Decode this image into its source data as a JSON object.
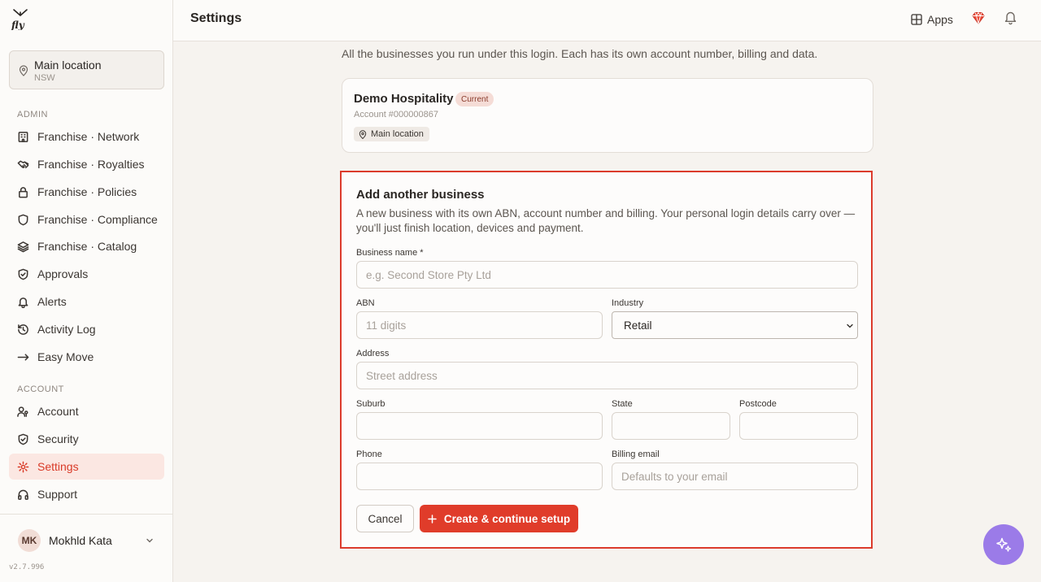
{
  "app": {
    "version": "v2.7.996"
  },
  "header": {
    "title": "Settings",
    "apps_label": "Apps"
  },
  "sidebar": {
    "location": {
      "name": "Main location",
      "state": "NSW"
    },
    "admin_label": "ADMIN",
    "account_label": "ACCOUNT",
    "admin_items": [
      {
        "label": "Franchise · Network",
        "icon": "building-icon"
      },
      {
        "label": "Franchise · Royalties",
        "icon": "handshake-icon"
      },
      {
        "label": "Franchise · Policies",
        "icon": "lock-icon"
      },
      {
        "label": "Franchise · Compliance",
        "icon": "shield-icon"
      },
      {
        "label": "Franchise · Catalog",
        "icon": "layers-icon"
      },
      {
        "label": "Approvals",
        "icon": "shield-check-icon"
      },
      {
        "label": "Alerts",
        "icon": "bell-icon"
      },
      {
        "label": "Activity Log",
        "icon": "history-icon"
      },
      {
        "label": "Easy Move",
        "icon": "arrow-right-icon"
      }
    ],
    "account_items": [
      {
        "label": "Account",
        "icon": "user-key-icon"
      },
      {
        "label": "Security",
        "icon": "shield-icon"
      },
      {
        "label": "Settings",
        "icon": "gear-icon",
        "active": true
      },
      {
        "label": "Support",
        "icon": "headphones-icon"
      }
    ],
    "user": {
      "initials": "MK",
      "name": "Mokhld Kata"
    }
  },
  "main": {
    "intro": "All the businesses you run under this login. Each has its own account number, billing and data.",
    "business": {
      "name": "Demo Hospitality",
      "badge": "Current",
      "account": "Account #000000867",
      "location": "Main location"
    },
    "add_business": {
      "title": "Add another business",
      "description": "A new business with its own ABN, account number and billing. Your personal login details carry over — you'll just finish location, devices and payment.",
      "fields": {
        "business_name": {
          "label": "Business name *",
          "placeholder": "e.g. Second Store Pty Ltd"
        },
        "abn": {
          "label": "ABN",
          "placeholder": "11 digits"
        },
        "industry": {
          "label": "Industry",
          "value": "Retail"
        },
        "address": {
          "label": "Address",
          "placeholder": "Street address"
        },
        "suburb": {
          "label": "Suburb",
          "placeholder": ""
        },
        "state": {
          "label": "State",
          "placeholder": ""
        },
        "postcode": {
          "label": "Postcode",
          "placeholder": ""
        },
        "phone": {
          "label": "Phone",
          "placeholder": ""
        },
        "billing_email": {
          "label": "Billing email",
          "placeholder": "Defaults to your email"
        }
      },
      "cancel_label": "Cancel",
      "create_label": "Create & continue setup"
    }
  },
  "colors": {
    "accent": "#e03c2a",
    "highlight_border": "#dc3b2c",
    "fab": "#9b7be8"
  }
}
